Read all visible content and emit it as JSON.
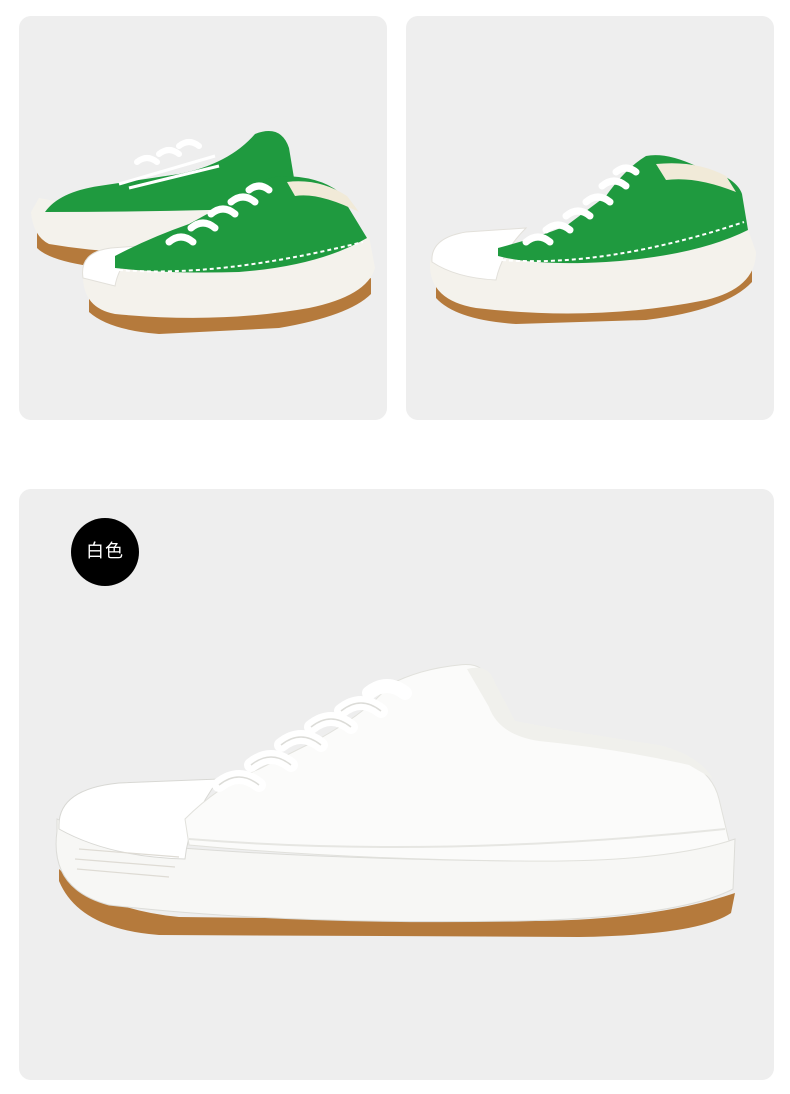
{
  "products": {
    "main": {
      "color_label": "白色"
    }
  },
  "colors": {
    "panel_bg": "#eeeeee",
    "shoe_green": "#1f9a3f",
    "shoe_white": "#f7f7f5",
    "sole_gum": "#b57a3c",
    "badge_bg": "#000000"
  },
  "icons": [
    "green-shoe-pair-image",
    "green-shoe-single-image",
    "white-shoe-image"
  ]
}
